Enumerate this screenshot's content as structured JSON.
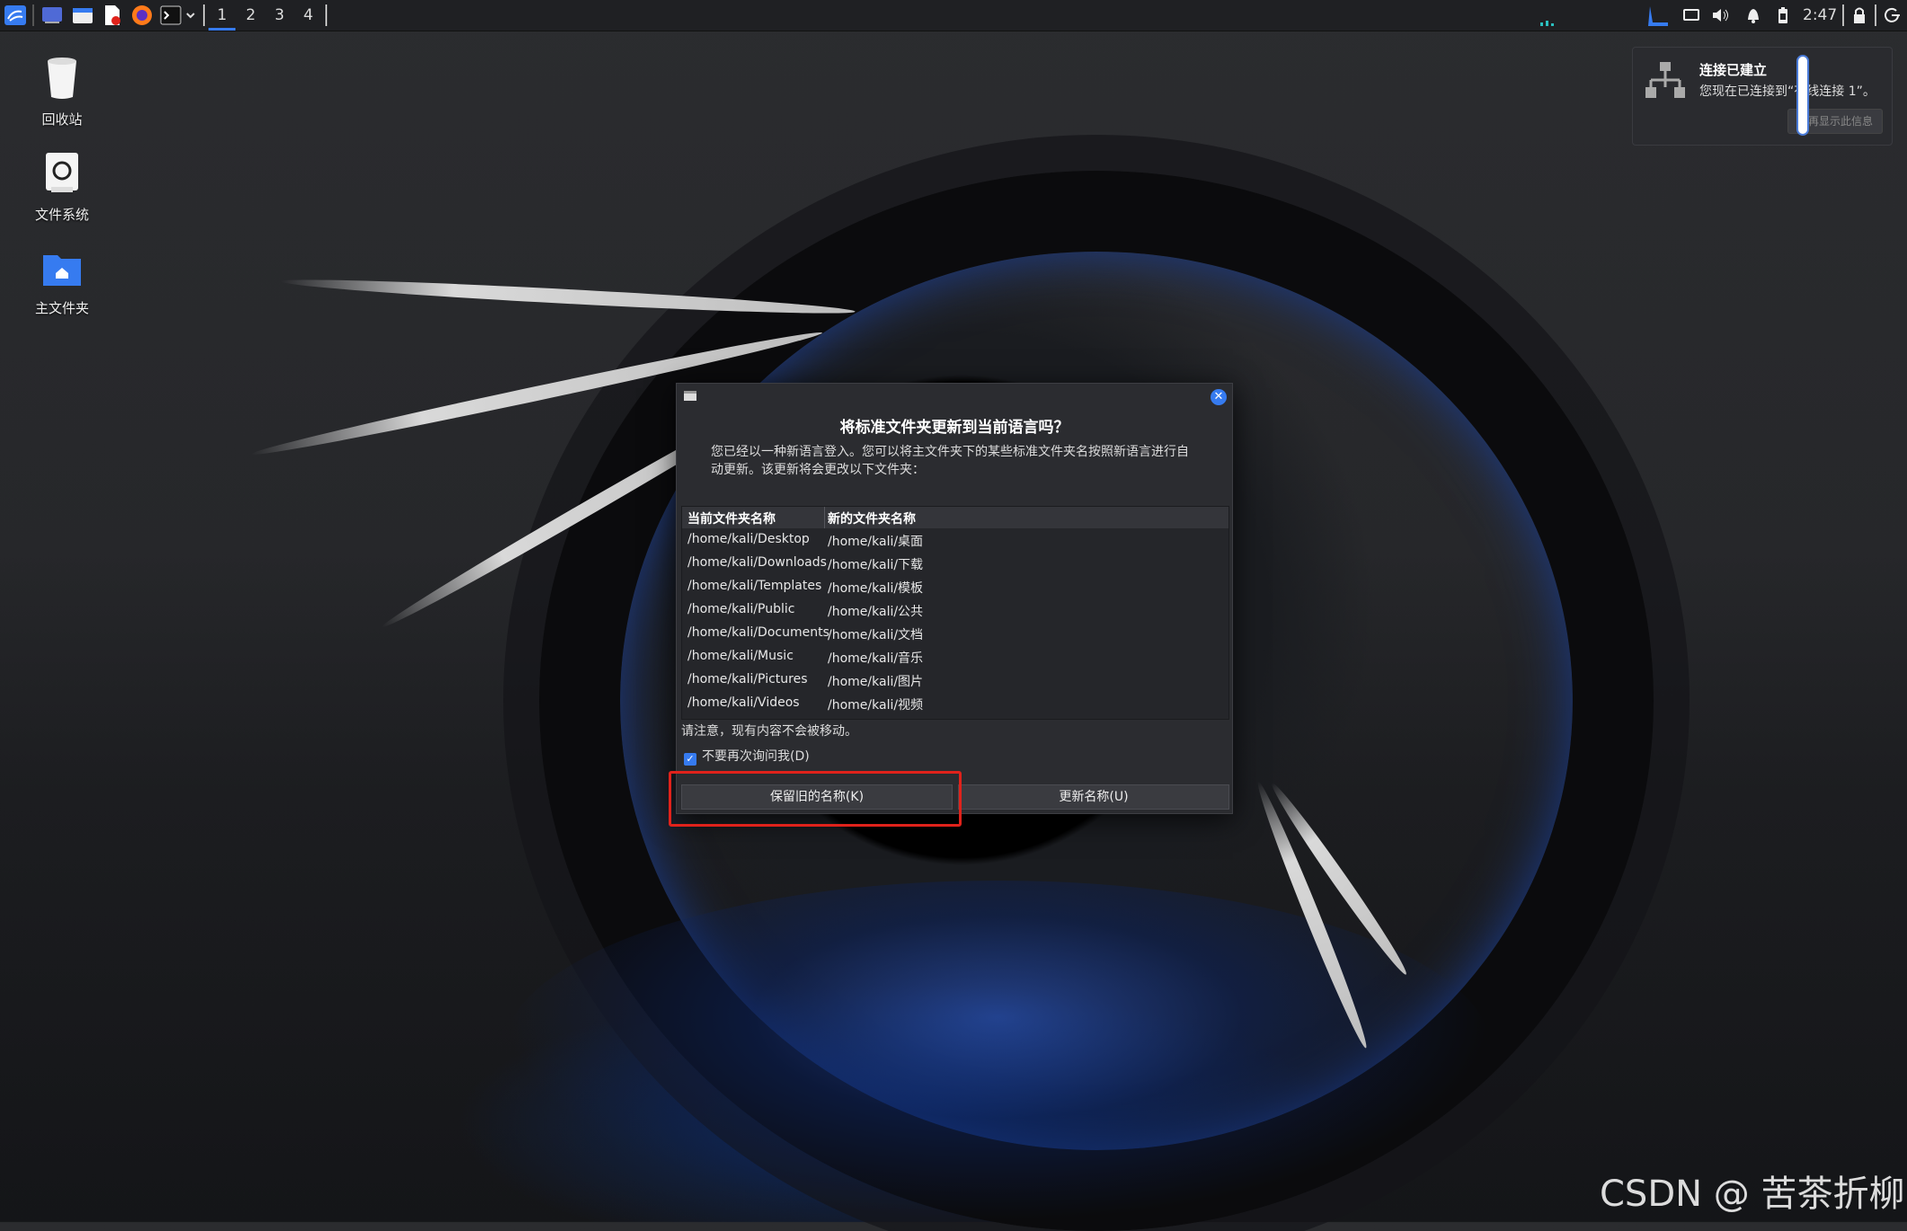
{
  "panel": {
    "workspaces": [
      "1",
      "2",
      "3",
      "4"
    ],
    "active_workspace": "1",
    "clock": "2:47",
    "icons": [
      "kali-menu-icon",
      "desktop-icon",
      "file-manager-icon",
      "text-editor-icon",
      "firefox-icon",
      "terminal-icon",
      "chevron-down-icon",
      "network-icon",
      "display-icon",
      "volume-icon",
      "bell-icon",
      "battery-icon",
      "lock-icon",
      "power-icon"
    ]
  },
  "desktop": {
    "trash_label": "回收站",
    "filesystem_label": "文件系统",
    "home_label": "主文件夹"
  },
  "notification": {
    "title": "连接已建立",
    "body": "您现在已连接到“有线连接 1”。",
    "button": "不再显示此信息"
  },
  "dialog": {
    "title": "将标准文件夹更新到当前语言吗？",
    "description": "您已经以一种新语言登入。您可以将主文件夹下的某些标准文件夹名按照新语言进行自动更新。该更新将会更改以下文件夹：",
    "columns": [
      "当前文件夹名称",
      "新的文件夹名称"
    ],
    "rows": [
      [
        "/home/kali/Desktop",
        "/home/kali/桌面"
      ],
      [
        "/home/kali/Downloads",
        "/home/kali/下载"
      ],
      [
        "/home/kali/Templates",
        "/home/kali/模板"
      ],
      [
        "/home/kali/Public",
        "/home/kali/公共"
      ],
      [
        "/home/kali/Documents",
        "/home/kali/文档"
      ],
      [
        "/home/kali/Music",
        "/home/kali/音乐"
      ],
      [
        "/home/kali/Pictures",
        "/home/kali/图片"
      ],
      [
        "/home/kali/Videos",
        "/home/kali/视频"
      ]
    ],
    "note": "请注意，现有内容不会被移动。",
    "dont_ask_label": "不要再次询问我(D)",
    "dont_ask_checked": true,
    "keep_button": "保留旧的名称(K)",
    "update_button": "更新名称(U)"
  },
  "colors": {
    "accent": "#367bf0",
    "highlight": "#e0221b"
  },
  "watermark": "CSDN @ 苦茶折柳"
}
